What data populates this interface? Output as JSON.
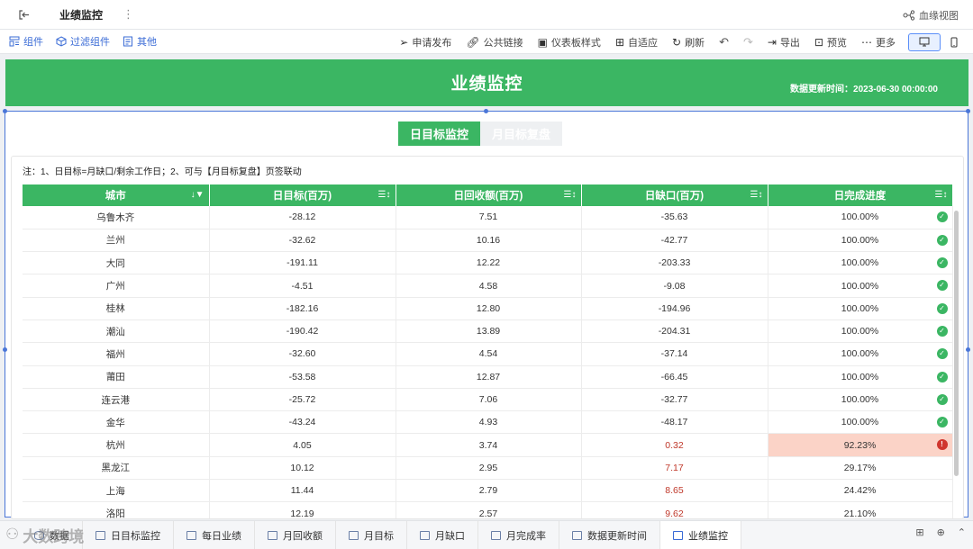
{
  "topbar": {
    "title": "业绩监控",
    "more": "⋮",
    "lineage": "血缘视图"
  },
  "toolbar": {
    "left": [
      "组件",
      "过滤组件",
      "其他"
    ],
    "right": [
      "申请发布",
      "公共链接",
      "仪表板样式",
      "自适应",
      "刷新"
    ],
    "right2": [
      "导出",
      "预览",
      "更多"
    ]
  },
  "banner": {
    "title": "业绩监控",
    "update": "数据更新时间：2023-06-30 00:00:00"
  },
  "tabs": [
    "日目标监控",
    "月目标复盘"
  ],
  "note": "注：1、日目标=月缺口/剩余工作日；2、可与【月目标复盘】页签联动",
  "table": {
    "headers": [
      "城市",
      "日目标(百万)",
      "日回收额(百万)",
      "日缺口(百万)",
      "日完成进度"
    ],
    "rows": [
      [
        "乌鲁木齐",
        "-28.12",
        "7.51",
        "-35.63",
        "100.00%",
        "ok"
      ],
      [
        "兰州",
        "-32.62",
        "10.16",
        "-42.77",
        "100.00%",
        "ok"
      ],
      [
        "大同",
        "-191.11",
        "12.22",
        "-203.33",
        "100.00%",
        "ok"
      ],
      [
        "广州",
        "-4.51",
        "4.58",
        "-9.08",
        "100.00%",
        "ok"
      ],
      [
        "桂林",
        "-182.16",
        "12.80",
        "-194.96",
        "100.00%",
        "ok"
      ],
      [
        "潮汕",
        "-190.42",
        "13.89",
        "-204.31",
        "100.00%",
        "ok"
      ],
      [
        "福州",
        "-32.60",
        "4.54",
        "-37.14",
        "100.00%",
        "ok"
      ],
      [
        "莆田",
        "-53.58",
        "12.87",
        "-66.45",
        "100.00%",
        "ok"
      ],
      [
        "连云港",
        "-25.72",
        "7.06",
        "-32.77",
        "100.00%",
        "ok"
      ],
      [
        "金华",
        "-43.24",
        "4.93",
        "-48.17",
        "100.00%",
        "ok"
      ],
      [
        "杭州",
        "4.05",
        "3.74",
        "0.32",
        "92.23%",
        "bad"
      ],
      [
        "黑龙江",
        "10.12",
        "2.95",
        "7.17",
        "29.17%",
        ""
      ],
      [
        "上海",
        "11.44",
        "2.79",
        "8.65",
        "24.42%",
        ""
      ],
      [
        "洛阳",
        "12.19",
        "2.57",
        "9.62",
        "21.10%",
        ""
      ]
    ]
  },
  "sheets": [
    "数据",
    "日目标监控",
    "每日业绩",
    "月回收额",
    "月目标",
    "月缺口",
    "月完成率",
    "数据更新时间",
    "业绩监控"
  ],
  "watermark": "大数跨境",
  "colors": {
    "accent": "#3bb663",
    "alert_bg": "#fbd3c7",
    "neg_text": "#c0392b",
    "selection": "#4a76d8"
  }
}
